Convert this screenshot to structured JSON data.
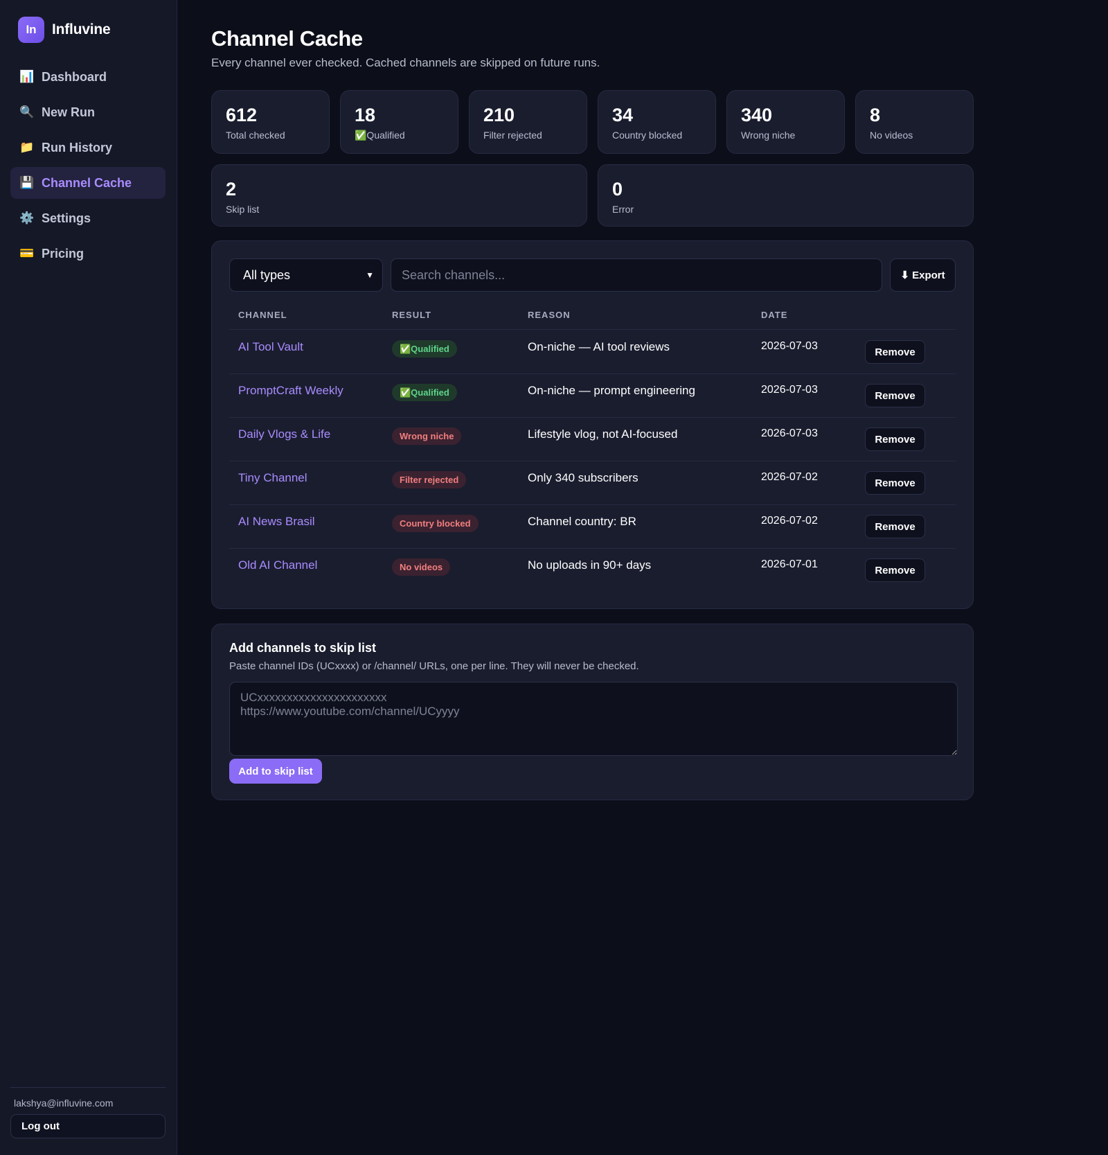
{
  "brand": {
    "logo_text": "In",
    "name": "Influvine"
  },
  "nav": [
    {
      "icon": "📊",
      "icon_name": "chart-icon",
      "label": "Dashboard"
    },
    {
      "icon": "🔍",
      "icon_name": "search-icon",
      "label": "New Run"
    },
    {
      "icon": "📁",
      "icon_name": "folder-icon",
      "label": "Run History"
    },
    {
      "icon": "💾",
      "icon_name": "floppy-disk-icon",
      "label": "Channel Cache",
      "active": true
    },
    {
      "icon": "⚙️",
      "icon_name": "gear-icon",
      "label": "Settings"
    },
    {
      "icon": "💳",
      "icon_name": "credit-card-icon",
      "label": "Pricing"
    }
  ],
  "user": {
    "email": "lakshya@influvine.com",
    "logout_label": "Log out"
  },
  "page": {
    "title": "Channel Cache",
    "subtitle": "Every channel ever checked. Cached channels are skipped on future runs."
  },
  "stats": [
    {
      "value": "612",
      "label": "Total checked"
    },
    {
      "value": "18",
      "label": "✅Qualified"
    },
    {
      "value": "210",
      "label": "Filter rejected"
    },
    {
      "value": "34",
      "label": "Country blocked"
    },
    {
      "value": "340",
      "label": "Wrong niche"
    },
    {
      "value": "8",
      "label": "No videos"
    },
    {
      "value": "2",
      "label": "Skip list"
    },
    {
      "value": "0",
      "label": "Error"
    }
  ],
  "filters": {
    "type_selected": "All types",
    "search_placeholder": "Search channels...",
    "export_label": "⬇ Export"
  },
  "table": {
    "headers": {
      "channel": "CHANNEL",
      "result": "RESULT",
      "reason": "REASON",
      "date": "DATE"
    },
    "remove_label": "Remove",
    "rows": [
      {
        "channel": "AI Tool Vault",
        "result": "✅Qualified",
        "status": "ok",
        "reason": "On-niche — AI tool reviews",
        "date": "2026-07-03"
      },
      {
        "channel": "PromptCraft Weekly",
        "result": "✅Qualified",
        "status": "ok",
        "reason": "On-niche — prompt engineering",
        "date": "2026-07-03"
      },
      {
        "channel": "Daily Vlogs & Life",
        "result": "Wrong niche",
        "status": "bad",
        "reason": "Lifestyle vlog, not AI-focused",
        "date": "2026-07-03"
      },
      {
        "channel": "Tiny Channel",
        "result": "Filter rejected",
        "status": "bad",
        "reason": "Only 340 subscribers",
        "date": "2026-07-02"
      },
      {
        "channel": "AI News Brasil",
        "result": "Country blocked",
        "status": "bad",
        "reason": "Channel country: BR",
        "date": "2026-07-02"
      },
      {
        "channel": "Old AI Channel",
        "result": "No videos",
        "status": "bad",
        "reason": "No uploads in 90+ days",
        "date": "2026-07-01"
      }
    ]
  },
  "skip_list": {
    "title": "Add channels to skip list",
    "description": "Paste channel IDs (UCxxxx) or /channel/ URLs, one per line. They will never be checked.",
    "placeholder": "UCxxxxxxxxxxxxxxxxxxxxxx\nhttps://www.youtube.com/channel/UCyyyy",
    "button_label": "Add to skip list"
  },
  "colors": {
    "accent": "#8b6cf6",
    "accent_text": "#a98cff",
    "background": "#0c0f1a",
    "panel": "#1a1d2e",
    "ok_badge": "#5fd38a",
    "bad_badge": "#f07f7f"
  }
}
